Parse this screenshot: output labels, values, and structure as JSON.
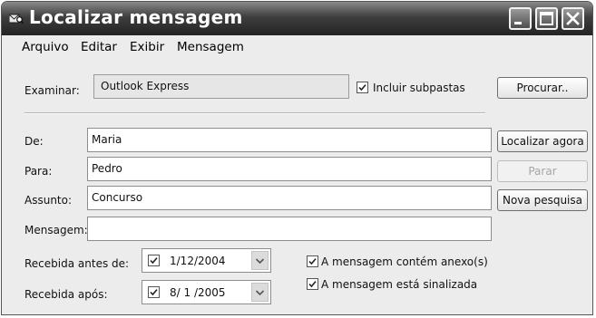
{
  "window": {
    "title": "Localizar mensagem"
  },
  "menu": [
    "Arquivo",
    "Editar",
    "Exibir",
    "Mensagem"
  ],
  "examinar": {
    "label": "Examinar:",
    "value": "Outlook Express"
  },
  "include_subfolders": {
    "label": "Incluir subpastas",
    "checked": true
  },
  "buttons": {
    "procurar": "Procurar..",
    "localizar_agora": "Localizar agora",
    "parar": "Parar",
    "nova_pesquisa": "Nova pesquisa"
  },
  "fields": {
    "de": {
      "label": "De:",
      "value": "Maria"
    },
    "para": {
      "label": "Para:",
      "value": "Pedro"
    },
    "assunto": {
      "label": "Assunto:",
      "value": "Concurso"
    },
    "mensagem": {
      "label": "Mensagem:",
      "value": ""
    }
  },
  "dates": {
    "recebida_antes": {
      "label": "Recebida antes de:",
      "value": "1/12/2004",
      "checked": true
    },
    "recebida_apos": {
      "label": "Recebida após:",
      "value": "8/ 1 /2005",
      "checked": true
    }
  },
  "options": {
    "anexo": {
      "label": "A mensagem contém anexo(s)",
      "checked": true
    },
    "sinalizada": {
      "label": "A mensagem está sinalizada",
      "checked": true
    }
  }
}
